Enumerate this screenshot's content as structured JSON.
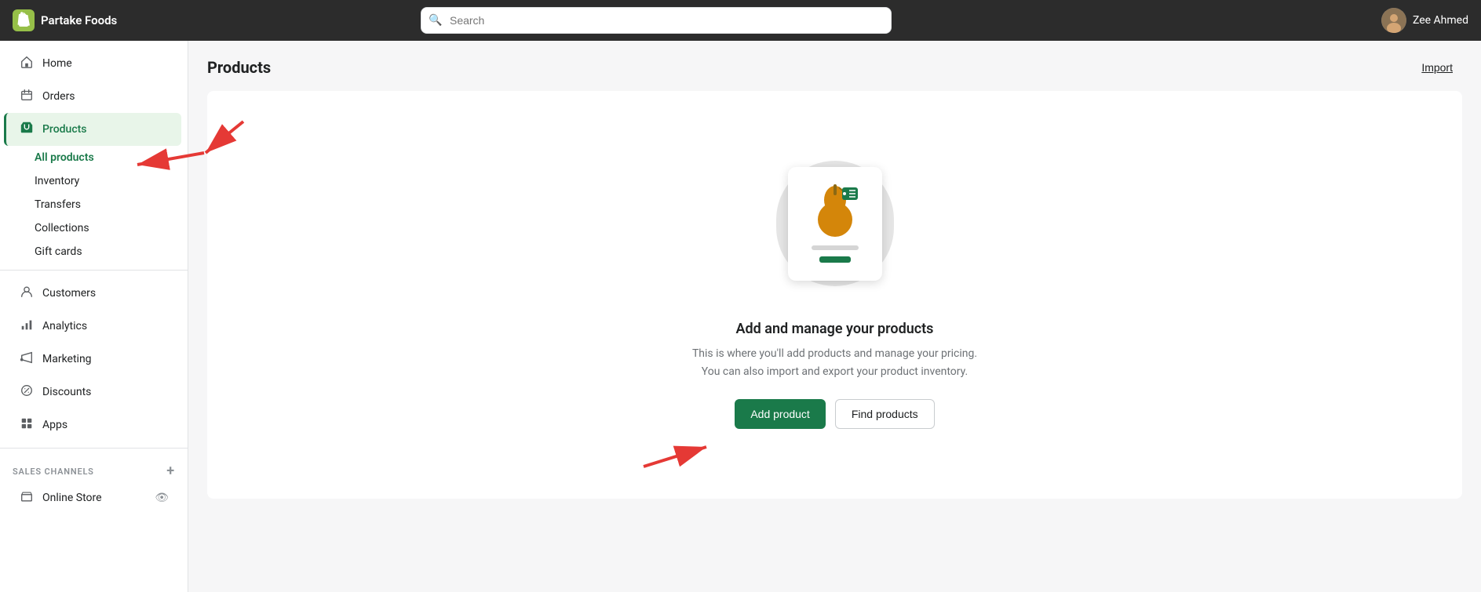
{
  "app": {
    "store_name": "Partake Foods",
    "user_name": "Zee Ahmed"
  },
  "topbar": {
    "search_placeholder": "Search"
  },
  "sidebar": {
    "items": [
      {
        "id": "home",
        "label": "Home",
        "icon": "🏠"
      },
      {
        "id": "orders",
        "label": "Orders",
        "icon": "📥"
      },
      {
        "id": "products",
        "label": "Products",
        "icon": "🏷️",
        "active": true
      },
      {
        "id": "customers",
        "label": "Customers",
        "icon": "👤"
      },
      {
        "id": "analytics",
        "label": "Analytics",
        "icon": "📊"
      },
      {
        "id": "marketing",
        "label": "Marketing",
        "icon": "📣"
      },
      {
        "id": "discounts",
        "label": "Discounts",
        "icon": "⚙️"
      },
      {
        "id": "apps",
        "label": "Apps",
        "icon": "⊞"
      }
    ],
    "products_sub": [
      {
        "id": "all-products",
        "label": "All products",
        "active": true
      },
      {
        "id": "inventory",
        "label": "Inventory"
      },
      {
        "id": "transfers",
        "label": "Transfers"
      },
      {
        "id": "collections",
        "label": "Collections"
      },
      {
        "id": "gift-cards",
        "label": "Gift cards"
      }
    ],
    "sales_channels_label": "SALES CHANNELS",
    "sales_channels": [
      {
        "id": "online-store",
        "label": "Online Store"
      }
    ]
  },
  "page": {
    "title": "Products",
    "import_label": "Import"
  },
  "empty_state": {
    "title": "Add and manage your products",
    "description": "This is where you'll add products and manage your pricing. You can also import and export your product inventory.",
    "add_product_label": "Add product",
    "find_products_label": "Find products"
  }
}
